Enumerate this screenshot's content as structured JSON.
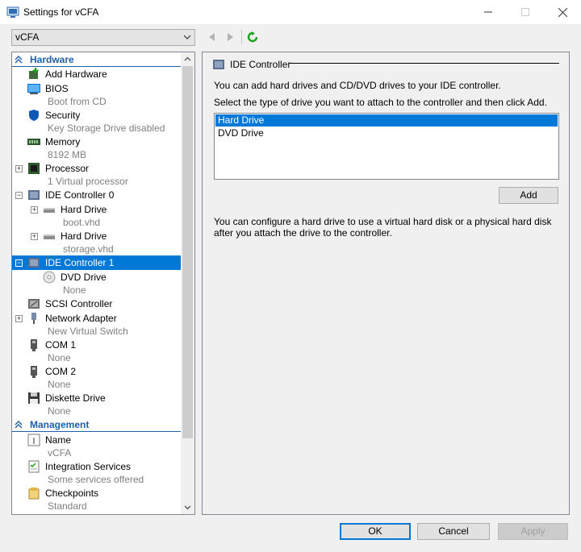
{
  "window": {
    "title": "Settings for vCFA"
  },
  "vm_select": {
    "value": "vCFA"
  },
  "tree": {
    "hardware_label": "Hardware",
    "management_label": "Management",
    "add_hardware": "Add Hardware",
    "bios": {
      "label": "BIOS",
      "sub": "Boot from CD"
    },
    "security": {
      "label": "Security",
      "sub": "Key Storage Drive disabled"
    },
    "memory": {
      "label": "Memory",
      "sub": "8192 MB"
    },
    "processor": {
      "label": "Processor",
      "sub": "1 Virtual processor"
    },
    "ide0": {
      "label": "IDE Controller 0"
    },
    "hd1": {
      "label": "Hard Drive",
      "sub": "boot.vhd"
    },
    "hd2": {
      "label": "Hard Drive",
      "sub": "storage.vhd"
    },
    "ide1": {
      "label": "IDE Controller 1"
    },
    "dvd": {
      "label": "DVD Drive",
      "sub": "None"
    },
    "scsi": {
      "label": "SCSI Controller"
    },
    "net": {
      "label": "Network Adapter",
      "sub": "New Virtual Switch"
    },
    "com1": {
      "label": "COM 1",
      "sub": "None"
    },
    "com2": {
      "label": "COM 2",
      "sub": "None"
    },
    "diskette": {
      "label": "Diskette Drive",
      "sub": "None"
    },
    "name": {
      "label": "Name",
      "sub": "vCFA"
    },
    "integration": {
      "label": "Integration Services",
      "sub": "Some services offered"
    },
    "checkpoints": {
      "label": "Checkpoints",
      "sub": "Standard"
    }
  },
  "panel": {
    "title": "IDE Controller",
    "line1": "You can add hard drives and CD/DVD drives to your IDE controller.",
    "line2": "Select the type of drive you want to attach to the controller and then click Add.",
    "options": [
      "Hard Drive",
      "DVD Drive"
    ],
    "add_label": "Add",
    "info": "You can configure a hard drive to use a virtual hard disk or a physical hard disk after you attach the drive to the controller."
  },
  "footer": {
    "ok": "OK",
    "cancel": "Cancel",
    "apply": "Apply"
  },
  "colors": {
    "accent": "#0078d7",
    "section": "#1e5fa8",
    "refresh": "#1aa11a"
  }
}
